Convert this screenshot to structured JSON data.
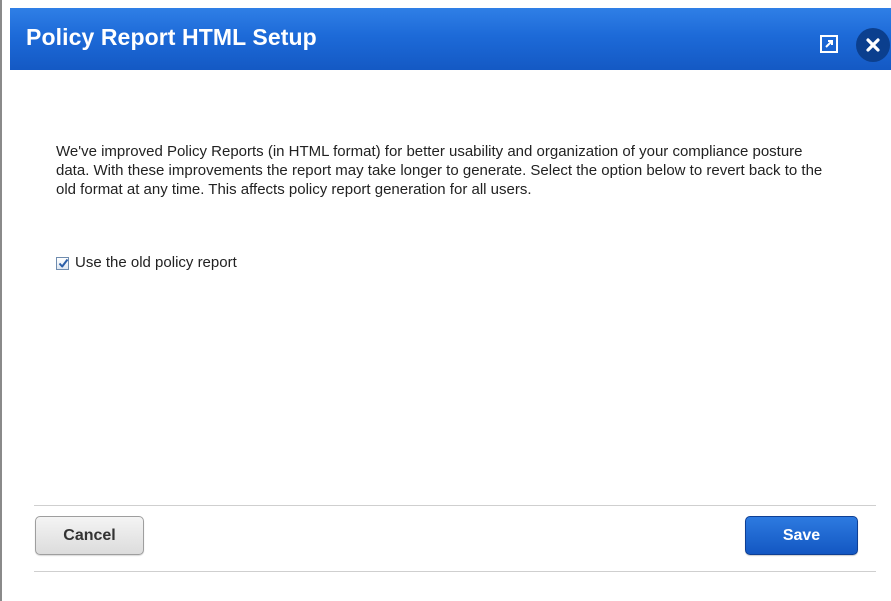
{
  "dialog": {
    "title": "Policy Report HTML Setup",
    "message": "We've improved Policy Reports (in HTML format) for better usability and organization of your compliance posture data. With these improvements the report may take longer to generate. Select the option below to revert back to the old format at any time. This affects policy report generation for all users.",
    "option": {
      "label": "Use the old policy report",
      "checked": true
    },
    "buttons": {
      "cancel_label": "Cancel",
      "save_label": "Save"
    },
    "icons": {
      "popout": "popout-icon",
      "close": "close-icon"
    },
    "colors": {
      "titlebar": "#1d6ad8",
      "close_circle": "#0b3f8e",
      "save_button": "#1a63d0"
    }
  }
}
